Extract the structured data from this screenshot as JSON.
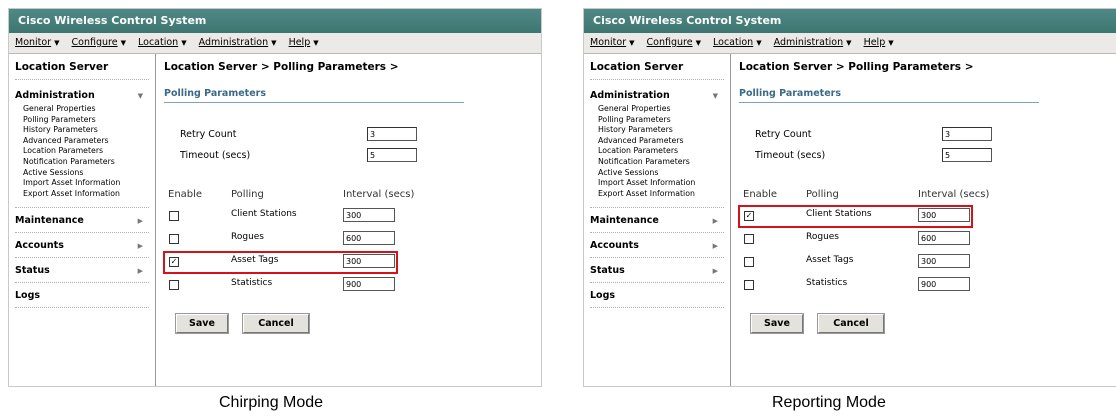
{
  "colors": {
    "titlebar": "#3e7571",
    "highlight": "#d4121a",
    "section_title": "#3a6a8a"
  },
  "menu_caret_icon": "triangle-down",
  "sidebar_arrow_icon": "triangle-right",
  "screens": [
    {
      "app_title": "Cisco Wireless Control System",
      "menu": [
        {
          "label": "Monitor"
        },
        {
          "label": "Configure"
        },
        {
          "label": "Location"
        },
        {
          "label": "Administration"
        },
        {
          "label": "Help"
        }
      ],
      "sidebar": {
        "title": "Location Server",
        "admin_label": "Administration",
        "admin_items": [
          "General Properties",
          "Polling Parameters",
          "History Parameters",
          "Advanced Parameters",
          "Location Parameters",
          "Notification Parameters",
          "Active Sessions",
          "Import Asset Information",
          "Export Asset Information"
        ],
        "sections": [
          "Maintenance",
          "Accounts",
          "Status",
          "Logs"
        ]
      },
      "breadcrumb": "Location Server > Polling Parameters >",
      "section_title": "Polling Parameters",
      "retry_label": "Retry Count",
      "retry_value": "3",
      "timeout_label": "Timeout (secs)",
      "timeout_value": "5",
      "headers": {
        "enable": "Enable",
        "polling": "Polling",
        "interval": "Interval (secs)"
      },
      "rows": [
        {
          "label": "Client Stations",
          "interval": "300",
          "checked": false
        },
        {
          "label": "Rogues",
          "interval": "600",
          "checked": false
        },
        {
          "label": "Asset Tags",
          "interval": "300",
          "checked": true
        },
        {
          "label": "Statistics",
          "interval": "900",
          "checked": false
        }
      ],
      "highlighted_row": 2,
      "save_label": "Save",
      "cancel_label": "Cancel",
      "caption": "Chirping Mode"
    },
    {
      "app_title": "Cisco Wireless Control System",
      "menu": [
        {
          "label": "Monitor"
        },
        {
          "label": "Configure"
        },
        {
          "label": "Location"
        },
        {
          "label": "Administration"
        },
        {
          "label": "Help"
        }
      ],
      "sidebar": {
        "title": "Location Server",
        "admin_label": "Administration",
        "admin_items": [
          "General Properties",
          "Polling Parameters",
          "History Parameters",
          "Advanced Parameters",
          "Location Parameters",
          "Notification Parameters",
          "Active Sessions",
          "Import Asset Information",
          "Export Asset Information"
        ],
        "sections": [
          "Maintenance",
          "Accounts",
          "Status",
          "Logs"
        ]
      },
      "breadcrumb": "Location Server > Polling Parameters >",
      "section_title": "Polling Parameters",
      "retry_label": "Retry Count",
      "retry_value": "3",
      "timeout_label": "Timeout (secs)",
      "timeout_value": "5",
      "headers": {
        "enable": "Enable",
        "polling": "Polling",
        "interval": "Interval (secs)"
      },
      "rows": [
        {
          "label": "Client Stations",
          "interval": "300",
          "checked": true
        },
        {
          "label": "Rogues",
          "interval": "600",
          "checked": false
        },
        {
          "label": "Asset Tags",
          "interval": "300",
          "checked": false
        },
        {
          "label": "Statistics",
          "interval": "900",
          "checked": false
        }
      ],
      "highlighted_row": 0,
      "save_label": "Save",
      "cancel_label": "Cancel",
      "caption": "Reporting Mode"
    }
  ]
}
